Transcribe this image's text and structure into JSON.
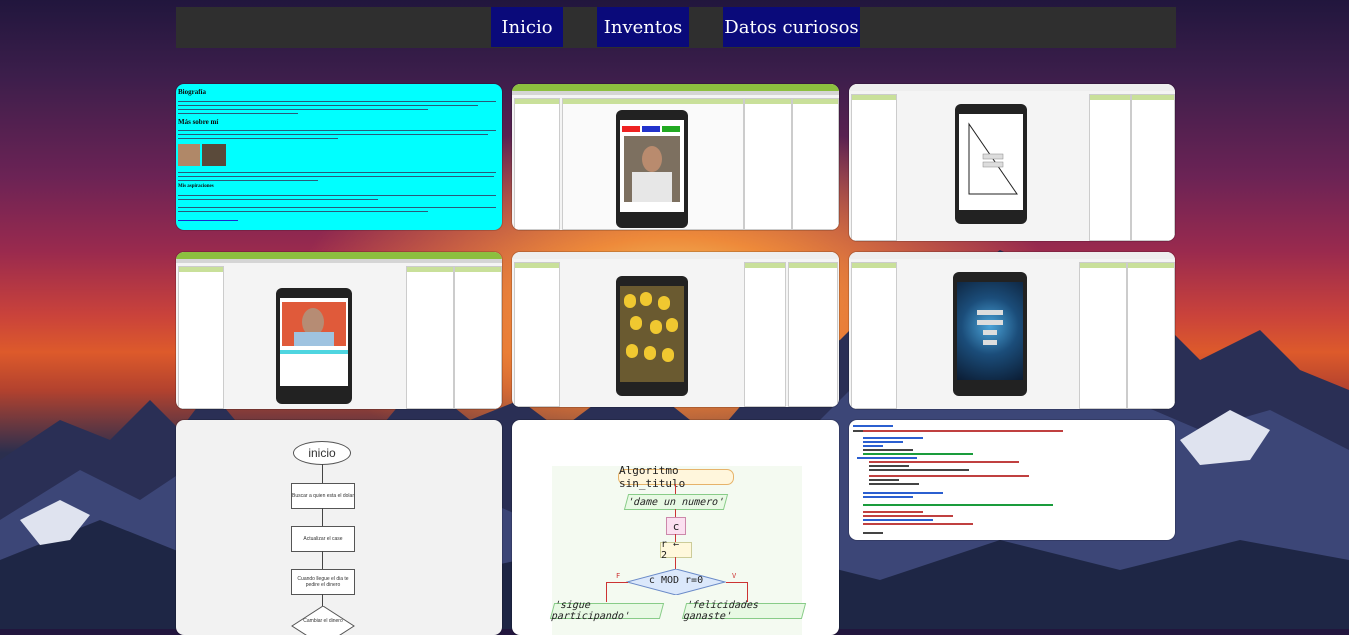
{
  "nav": {
    "items": [
      {
        "label": "Inicio"
      },
      {
        "label": "Inventos"
      },
      {
        "label": "Datos curiosos"
      }
    ]
  },
  "gallery": {
    "bio": {
      "title": "Biografía",
      "subtitle1": "Más sobre mí",
      "subtitle2": "Mis aspiraciones"
    },
    "flowchart": {
      "start": "inicio",
      "step1": "Buscar a quien esta el dolar",
      "step2": "Actualizar el case",
      "step3": "Cuando llegue el dia te pedire el dinero",
      "decision": "Cambiar el dinero"
    },
    "pseint": {
      "title": "Algoritmo sin_titulo",
      "prompt": "'dame un numero'",
      "var_c": "c",
      "assign": "r ← 2",
      "condition": "c MOD r=0",
      "false_label": "F",
      "true_label": "V",
      "left_out": "'sigue participando'",
      "right_out": "'felicidades ganaste'"
    }
  },
  "colors": {
    "nav_bg": "#2f2f2f",
    "nav_button": "#0a0a7a",
    "bio_bg": "#00ffff",
    "appinventor_green": "#8cbf3f"
  }
}
